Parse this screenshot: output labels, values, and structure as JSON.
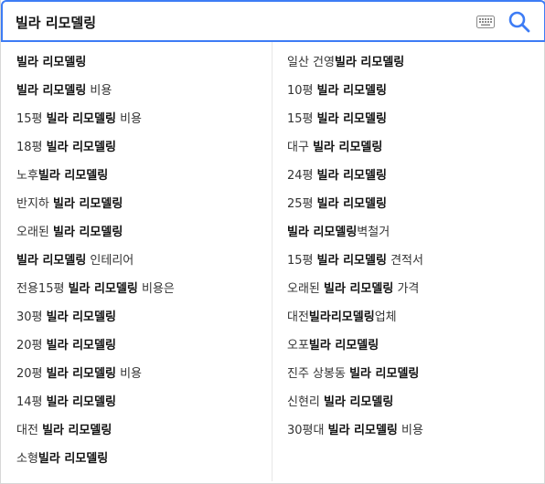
{
  "search": {
    "value": "빌라 리모델링",
    "keyboard_icon": "keyboard-icon",
    "search_icon": "search-icon",
    "accent_color": "#3d7cf5"
  },
  "suggestions_left": [
    [
      {
        "t": "빌라 리모델링",
        "b": true
      }
    ],
    [
      {
        "t": "빌라 리모델링",
        "b": true
      },
      {
        "t": " 비용",
        "b": false
      }
    ],
    [
      {
        "t": "15평 ",
        "b": false
      },
      {
        "t": "빌라 리모델링",
        "b": true
      },
      {
        "t": " 비용",
        "b": false
      }
    ],
    [
      {
        "t": "18평 ",
        "b": false
      },
      {
        "t": "빌라 리모델링",
        "b": true
      }
    ],
    [
      {
        "t": "노후",
        "b": false
      },
      {
        "t": "빌라 리모델링",
        "b": true
      }
    ],
    [
      {
        "t": "반지하 ",
        "b": false
      },
      {
        "t": "빌라 리모델링",
        "b": true
      }
    ],
    [
      {
        "t": "오래된 ",
        "b": false
      },
      {
        "t": "빌라 리모델링",
        "b": true
      }
    ],
    [
      {
        "t": "빌라 리모델링",
        "b": true
      },
      {
        "t": " 인테리어",
        "b": false
      }
    ],
    [
      {
        "t": "전용15평 ",
        "b": false
      },
      {
        "t": "빌라 리모델링",
        "b": true
      },
      {
        "t": " 비용은",
        "b": false
      }
    ],
    [
      {
        "t": "30평 ",
        "b": false
      },
      {
        "t": "빌라 리모델링",
        "b": true
      }
    ],
    [
      {
        "t": "20평 ",
        "b": false
      },
      {
        "t": "빌라 리모델링",
        "b": true
      }
    ],
    [
      {
        "t": "20평 ",
        "b": false
      },
      {
        "t": "빌라 리모델링",
        "b": true
      },
      {
        "t": " 비용",
        "b": false
      }
    ],
    [
      {
        "t": "14평 ",
        "b": false
      },
      {
        "t": "빌라 리모델링",
        "b": true
      }
    ],
    [
      {
        "t": "대전 ",
        "b": false
      },
      {
        "t": "빌라 리모델링",
        "b": true
      }
    ],
    [
      {
        "t": "소형",
        "b": false
      },
      {
        "t": "빌라 리모델링",
        "b": true
      }
    ]
  ],
  "suggestions_right": [
    [
      {
        "t": "일산 건영",
        "b": false
      },
      {
        "t": "빌라 리모델링",
        "b": true
      }
    ],
    [
      {
        "t": "10평 ",
        "b": false
      },
      {
        "t": "빌라 리모델링",
        "b": true
      }
    ],
    [
      {
        "t": "15평 ",
        "b": false
      },
      {
        "t": "빌라 리모델링",
        "b": true
      }
    ],
    [
      {
        "t": "대구 ",
        "b": false
      },
      {
        "t": "빌라 리모델링",
        "b": true
      }
    ],
    [
      {
        "t": "24평 ",
        "b": false
      },
      {
        "t": "빌라 리모델링",
        "b": true
      }
    ],
    [
      {
        "t": "25평 ",
        "b": false
      },
      {
        "t": "빌라 리모델링",
        "b": true
      }
    ],
    [
      {
        "t": "빌라 리모델링",
        "b": true
      },
      {
        "t": "벽철거",
        "b": false
      }
    ],
    [
      {
        "t": "15평 ",
        "b": false
      },
      {
        "t": "빌라 리모델링",
        "b": true
      },
      {
        "t": " 견적서",
        "b": false
      }
    ],
    [
      {
        "t": "오래된 ",
        "b": false
      },
      {
        "t": "빌라 리모델링",
        "b": true
      },
      {
        "t": " 가격",
        "b": false
      }
    ],
    [
      {
        "t": "대전",
        "b": false
      },
      {
        "t": "빌라리모델링",
        "b": true
      },
      {
        "t": "업체",
        "b": false
      }
    ],
    [
      {
        "t": "오포",
        "b": false
      },
      {
        "t": "빌라 리모델링",
        "b": true
      }
    ],
    [
      {
        "t": "진주 상봉동 ",
        "b": false
      },
      {
        "t": "빌라 리모델링",
        "b": true
      }
    ],
    [
      {
        "t": "신현리 ",
        "b": false
      },
      {
        "t": "빌라 리모델링",
        "b": true
      }
    ],
    [
      {
        "t": "30평대 ",
        "b": false
      },
      {
        "t": "빌라 리모델링",
        "b": true
      },
      {
        "t": " 비용",
        "b": false
      }
    ]
  ]
}
